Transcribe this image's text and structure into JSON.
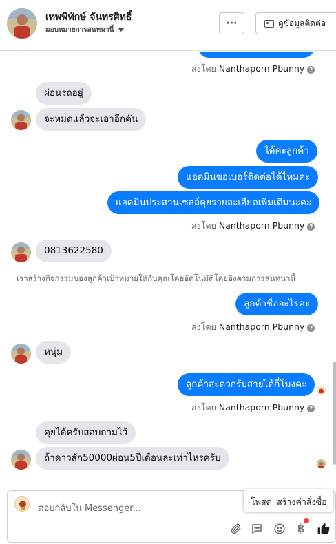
{
  "header": {
    "contact_name": "เทพพิทักษ์ จันทรศิทธิ์",
    "assign_label": "มอบหมายการสนทนานี้",
    "more_label": "···",
    "view_contact_label": "ดูข้อมูลติดต่อ"
  },
  "messages": {
    "sent_by_prefix": "ส่งโดย",
    "sender_name": "Nanthaporn Pbunny",
    "help_glyph": "?",
    "m1": "ผ่อนรถอยู่",
    "m2": "จะหมดแล้วจะเอาอีกคัน",
    "m3": "ได้ค่ะลูกค้า",
    "m4": "แอดมินขอเบอร์ติดต่อได้ไหมคะ",
    "m5": "แอดมินประสานเซลล์คุยรายละเอียดเพิ่มเติมนะคะ",
    "m6": "0813622580",
    "system_note": "เราสร้างกิจกรรมของลูกค้าเป้าหมายให้กับคุณโดยอัตโนมัติโดยอิงตามการสนทนานี้",
    "m7": "ลูกค้าชื่ออะไรคะ",
    "m8": "หนุ่ม",
    "m9": "ลูกค้าสะดวกรับสายได้กี่โมงคะ",
    "m10": "คุยได้ครับสอบถามไว้",
    "m11": "ถ้าดาวสัก50000ผ่อน5ปีเดือนละเท่าไหรครับ"
  },
  "composer": {
    "placeholder": "ตอบกลับใน Messenger...",
    "popup_left": "โพสต",
    "popup_right": "สร้างคำสั่งซื้อ",
    "baht_glyph": "฿"
  },
  "colors": {
    "outgoing": "#0a7cff",
    "incoming": "#e4e6eb",
    "like": "#1c1e21",
    "notification": "#fa383e"
  },
  "icons": [
    "more-icon",
    "contact-card-icon",
    "chevron-down-icon",
    "help-icon",
    "attachment-icon",
    "saved-reply-icon",
    "emoji-icon",
    "baht-icon",
    "thumbs-up-icon"
  ]
}
